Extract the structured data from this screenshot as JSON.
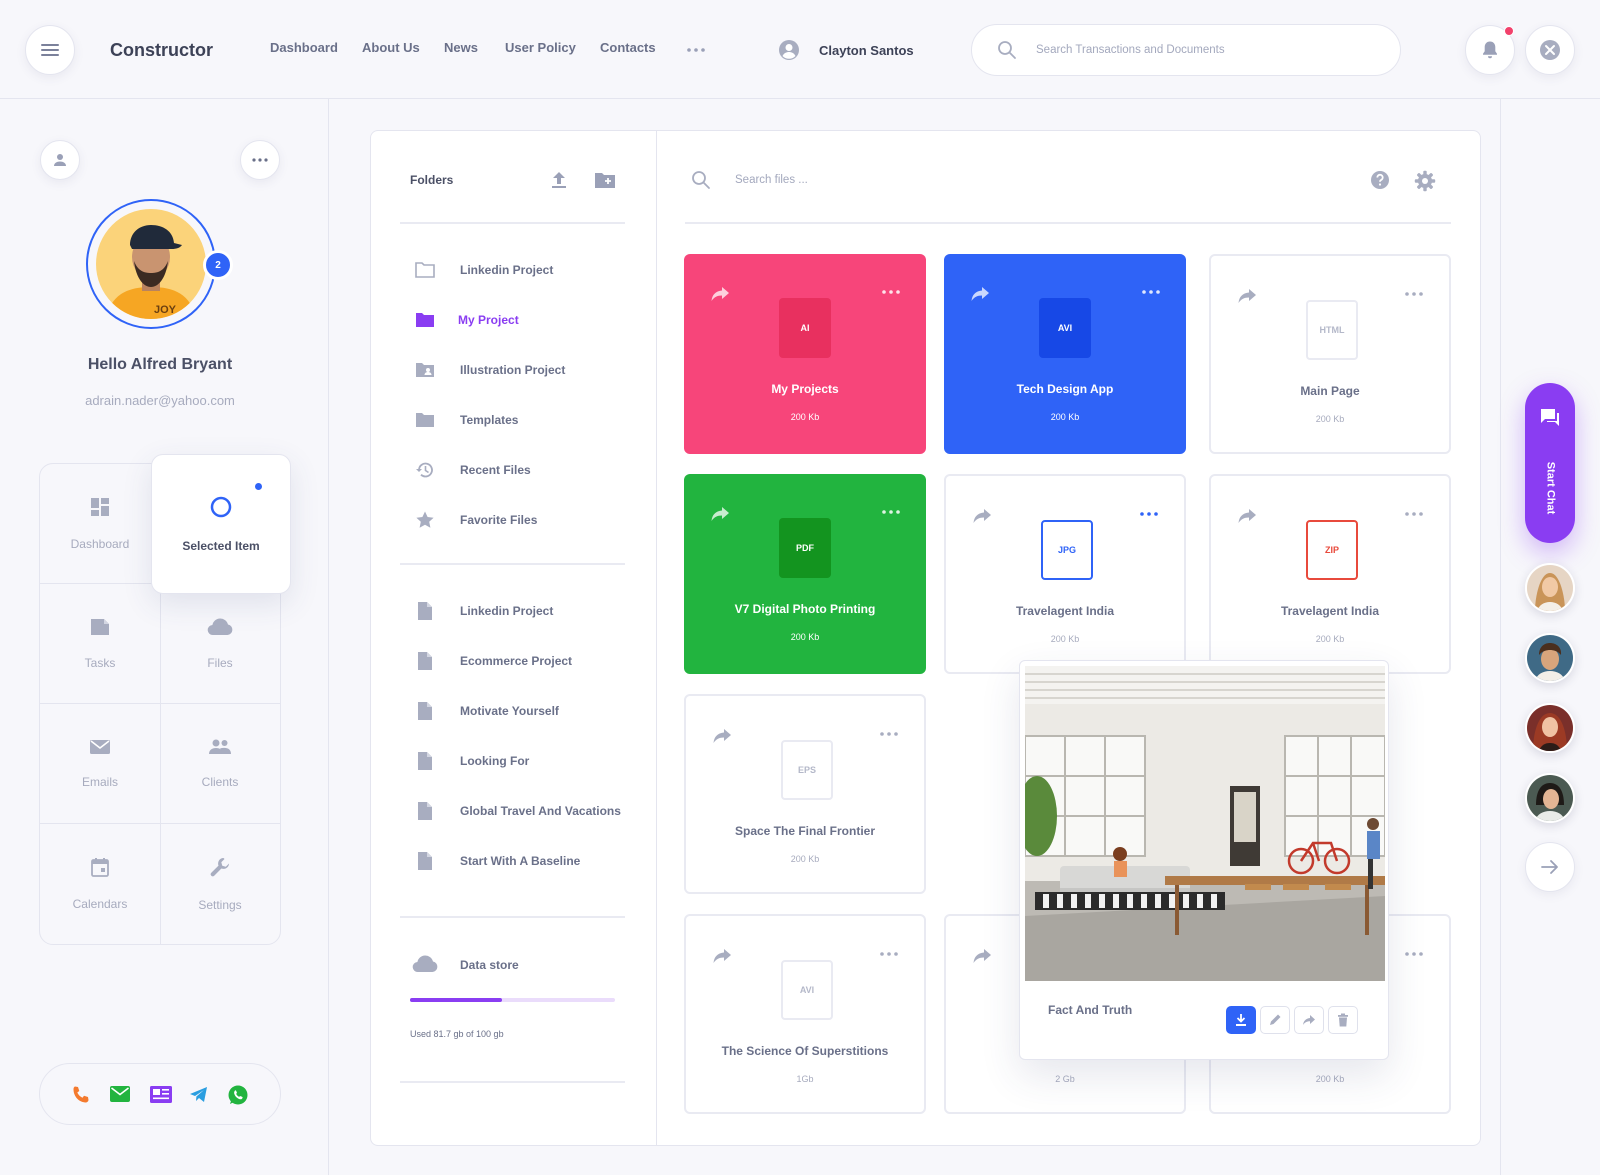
{
  "header": {
    "brand": "Constructor",
    "nav": [
      "Dashboard",
      "About Us",
      "News",
      "User Policy",
      "Contacts"
    ],
    "user_name": "Clayton Santos",
    "search_placeholder": "Search Transactions and Documents",
    "notification_color": "#f2416b"
  },
  "profile": {
    "greeting": "Hello Alfred Bryant",
    "email": "adrain.nader@yahoo.com",
    "badge_count": "2"
  },
  "menu": {
    "dashboard": "Dashboard",
    "selected": "Selected Item",
    "tasks": "Tasks",
    "files": "Files",
    "emails": "Emails",
    "clients": "Clients",
    "calendars": "Calendars",
    "settings": "Settings"
  },
  "contact_icons": [
    "phone-icon",
    "mail-icon",
    "news-icon",
    "telegram-icon",
    "whatsapp-icon"
  ],
  "folders": {
    "title": "Folders",
    "items": [
      "Linkedin Project",
      "My Project",
      "Illustration Project",
      "Templates",
      "Recent Files",
      "Favorite Files"
    ],
    "files": [
      "Linkedin Project",
      "Ecommerce Project",
      "Motivate Yourself",
      "Looking For",
      "Global Travel And Vacations",
      "Start With A Baseline"
    ],
    "storage_label": "Data store",
    "storage_used_text": "Used 81.7 gb of 100 gb",
    "storage_fraction": 0.45
  },
  "files_search_placeholder": "Search files ...",
  "cards": [
    {
      "name": "My Projects",
      "size": "200 Kb",
      "ext": "AI",
      "color": "#f7457a"
    },
    {
      "name": "Tech Design App",
      "size": "200 Kb",
      "ext": "AVI",
      "color": "#2f63f7"
    },
    {
      "name": "Main Page",
      "size": "200 Kb",
      "ext": "HTML"
    },
    {
      "name": "V7 Digital Photo Printing",
      "size": "200 Kb",
      "ext": "PDF",
      "color": "#22b43f"
    },
    {
      "name": "Travelagent India",
      "size": "200 Kb",
      "ext": "JPG"
    },
    {
      "name": "Travelagent India",
      "size": "200 Kb",
      "ext": "ZIP"
    },
    {
      "name": "Space The Final Frontier",
      "size": "200 Kb",
      "ext": "EPS"
    },
    {
      "name": "The Science Of Superstitions",
      "size": "1Gb",
      "ext": "AVI"
    },
    {
      "size": "2 Gb"
    },
    {
      "size": "200 Kb"
    }
  ],
  "popup": {
    "title": "Fact And Truth"
  },
  "chat": {
    "label": "Start Chat"
  }
}
